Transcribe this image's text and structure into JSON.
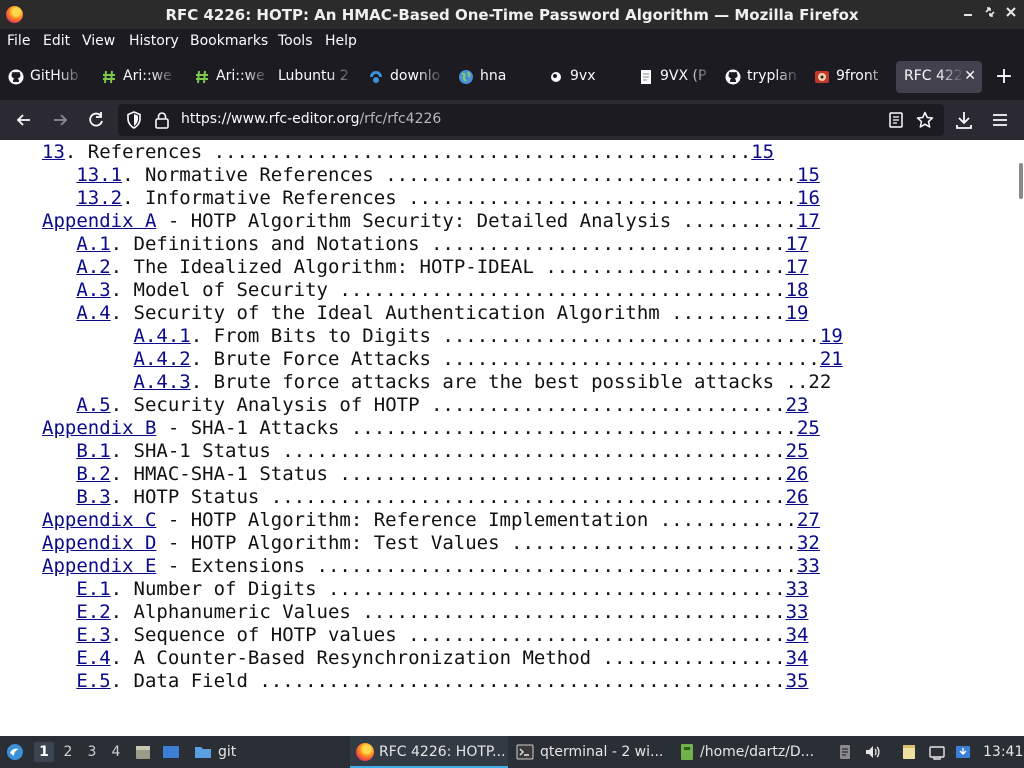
{
  "window": {
    "title": "RFC 4226: HOTP: An HMAC-Based One-Time Password Algorithm — Mozilla Firefox",
    "controls": {
      "minimize": "–",
      "restore": "⤢",
      "close": "✕"
    }
  },
  "menubar": {
    "items": [
      "File",
      "Edit",
      "View",
      "History",
      "Bookmarks",
      "Tools",
      "Help"
    ]
  },
  "tabs": [
    {
      "label": "GitHub",
      "icon": "github-icon"
    },
    {
      "label": "Ari::we",
      "icon": "hash-icon"
    },
    {
      "label": "Ari::we",
      "icon": "hash-icon"
    },
    {
      "label": "Lubuntu 2",
      "icon": ""
    },
    {
      "label": "downlo",
      "icon": "download-site-icon"
    },
    {
      "label": "hna",
      "icon": "globe-icon"
    },
    {
      "label": "9vx",
      "icon": "9vx-icon"
    },
    {
      "label": "9VX (P",
      "icon": "document-icon"
    },
    {
      "label": "tryplan",
      "icon": "github-icon"
    },
    {
      "label": "9front",
      "icon": "9front-icon"
    },
    {
      "label": "RFC 422",
      "icon": "",
      "active": true
    }
  ],
  "tab_close": "✕",
  "new_tab": "+",
  "urlbar": {
    "host": "https://www.rfc-editor.org",
    "path": "/rfc/rfc4226"
  },
  "toc": [
    {
      "indent": "",
      "link": "13",
      "rest": ". References ...............................................",
      "page": "15"
    },
    {
      "indent": "   ",
      "link": "13.1",
      "rest": ". Normative References ....................................",
      "page": "15"
    },
    {
      "indent": "   ",
      "link": "13.2",
      "rest": ". Informative References ..................................",
      "page": "16"
    },
    {
      "indent": "",
      "link": "Appendix A",
      "rest": " - HOTP Algorithm Security: Detailed Analysis ..........",
      "page": "17"
    },
    {
      "indent": "   ",
      "link": "A.1",
      "rest": ". Definitions and Notations ...............................",
      "page": "17"
    },
    {
      "indent": "   ",
      "link": "A.2",
      "rest": ". The Idealized Algorithm: HOTP-IDEAL .....................",
      "page": "17"
    },
    {
      "indent": "   ",
      "link": "A.3",
      "rest": ". Model of Security .......................................",
      "page": "18"
    },
    {
      "indent": "   ",
      "link": "A.4",
      "rest": ". Security of the Ideal Authentication Algorithm ..........",
      "page": "19"
    },
    {
      "indent": "        ",
      "link": "A.4.1",
      "rest": ". From Bits to Digits .................................",
      "page": "19"
    },
    {
      "indent": "        ",
      "link": "A.4.2",
      "rest": ". Brute Force Attacks .................................",
      "page": "21"
    },
    {
      "indent": "        ",
      "link": "A.4.3",
      "rest": ". Brute force attacks are the best possible attacks ..22",
      "page": ""
    },
    {
      "indent": "   ",
      "link": "A.5",
      "rest": ". Security Analysis of HOTP ...............................",
      "page": "23"
    },
    {
      "indent": "",
      "link": "Appendix B",
      "rest": " - SHA-1 Attacks .......................................",
      "page": "25"
    },
    {
      "indent": "   ",
      "link": "B.1",
      "rest": ". SHA-1 Status ............................................",
      "page": "25"
    },
    {
      "indent": "   ",
      "link": "B.2",
      "rest": ". HMAC-SHA-1 Status .......................................",
      "page": "26"
    },
    {
      "indent": "   ",
      "link": "B.3",
      "rest": ". HOTP Status .............................................",
      "page": "26"
    },
    {
      "indent": "",
      "link": "Appendix C",
      "rest": " - HOTP Algorithm: Reference Implementation ............",
      "page": "27"
    },
    {
      "indent": "",
      "link": "Appendix D",
      "rest": " - HOTP Algorithm: Test Values .........................",
      "page": "32"
    },
    {
      "indent": "",
      "link": "Appendix E",
      "rest": " - Extensions ..........................................",
      "page": "33"
    },
    {
      "indent": "   ",
      "link": "E.1",
      "rest": ". Number of Digits ........................................",
      "page": "33"
    },
    {
      "indent": "   ",
      "link": "E.2",
      "rest": ". Alphanumeric Values .....................................",
      "page": "33"
    },
    {
      "indent": "   ",
      "link": "E.3",
      "rest": ". Sequence of HOTP values .................................",
      "page": "34"
    },
    {
      "indent": "   ",
      "link": "E.4",
      "rest": ". A Counter-Based Resynchronization Method ................",
      "page": "34"
    },
    {
      "indent": "   ",
      "link": "E.5",
      "rest": ". Data Field ..............................................",
      "page": "35"
    }
  ],
  "taskbar": {
    "workspaces": [
      "1",
      "2",
      "3",
      "4"
    ],
    "active_workspace": "1",
    "quicklaunch": [
      {
        "name": "files-icon",
        "label": ""
      },
      {
        "name": "desktop-icon",
        "label": ""
      },
      {
        "name": "folder-git",
        "label": "git"
      }
    ],
    "tasks": [
      {
        "label": "RFC 4226: HOTP...",
        "icon": "firefox-icon",
        "active": true
      },
      {
        "label": "qterminal - 2 wi...",
        "icon": "terminal-icon"
      },
      {
        "label": "/home/dartz/D...",
        "icon": "file-manager-icon"
      }
    ],
    "clock": "13:41"
  },
  "colors": {
    "link": "#0a0a8a",
    "titlebar": "#2b2b2b",
    "toolbar": "#1c1b22",
    "navbar": "#2b2a33",
    "active_tab": "#42414d",
    "taskbar": "#2a2f36"
  }
}
